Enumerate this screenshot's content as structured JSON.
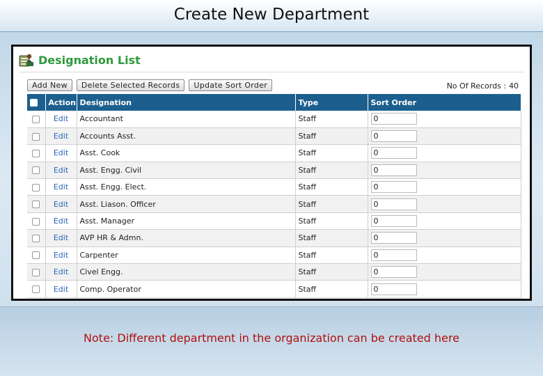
{
  "slide": {
    "title": "Create New Department",
    "note": "Note:  Different department in the organization can be created here"
  },
  "list": {
    "title": "Designation List",
    "icon": "people-list-icon",
    "accent_color": "#2e9a3c",
    "header_color": "#1c5f8e"
  },
  "toolbar": {
    "add_new_label": "Add New",
    "delete_label": "Delete Selected Records",
    "update_sort_label": "Update Sort Order"
  },
  "records": {
    "label": "No Of Records :",
    "count": "40"
  },
  "table": {
    "headers": {
      "action": "Action",
      "designation": "Designation",
      "type": "Type",
      "sort_order": "Sort Order"
    },
    "rows": [
      {
        "action": "Edit",
        "designation": "Accountant",
        "type": "Staff",
        "sort_order": "0"
      },
      {
        "action": "Edit",
        "designation": "Accounts Asst.",
        "type": "Staff",
        "sort_order": "0"
      },
      {
        "action": "Edit",
        "designation": "Asst. Cook",
        "type": "Staff",
        "sort_order": "0"
      },
      {
        "action": "Edit",
        "designation": "Asst. Engg. Civil",
        "type": "Staff",
        "sort_order": "0"
      },
      {
        "action": "Edit",
        "designation": "Asst. Engg. Elect.",
        "type": "Staff",
        "sort_order": "0"
      },
      {
        "action": "Edit",
        "designation": "Asst. Liason. Officer",
        "type": "Staff",
        "sort_order": "0"
      },
      {
        "action": "Edit",
        "designation": "Asst. Manager",
        "type": "Staff",
        "sort_order": "0"
      },
      {
        "action": "Edit",
        "designation": "AVP HR & Admn.",
        "type": "Staff",
        "sort_order": "0"
      },
      {
        "action": "Edit",
        "designation": "Carpenter",
        "type": "Staff",
        "sort_order": "0"
      },
      {
        "action": "Edit",
        "designation": "Civel Engg.",
        "type": "Staff",
        "sort_order": "0"
      },
      {
        "action": "Edit",
        "designation": "Comp. Operator",
        "type": "Staff",
        "sort_order": "0"
      }
    ]
  }
}
